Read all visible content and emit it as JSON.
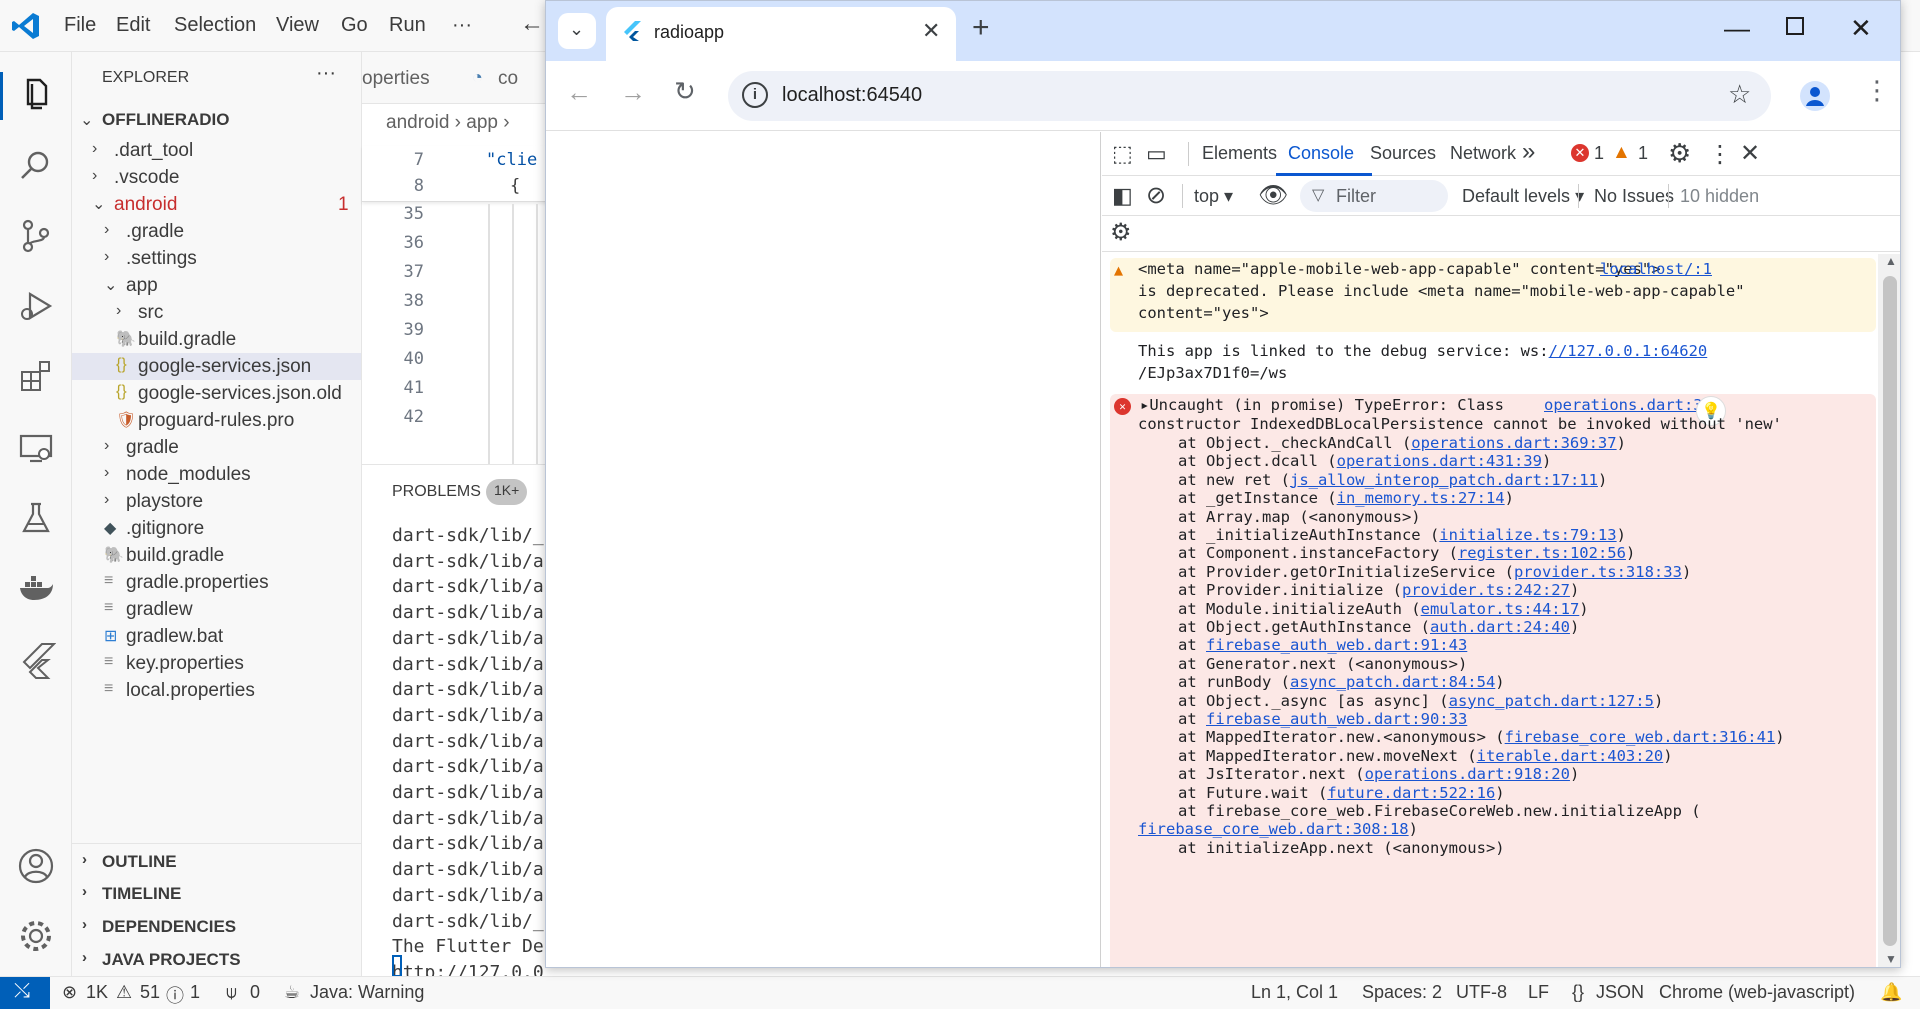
{
  "vscode": {
    "menu": [
      "File",
      "Edit",
      "Selection",
      "View",
      "Go",
      "Run",
      "···"
    ],
    "explorer": {
      "title": "EXPLORER",
      "more": "···",
      "root": "OFFLINERADIO",
      "items": [
        {
          "label": ".dart_tool",
          "depth": 1,
          "kind": "folder",
          "open": false
        },
        {
          "label": ".vscode",
          "depth": 1,
          "kind": "folder",
          "open": false
        },
        {
          "label": "android",
          "depth": 1,
          "kind": "folder",
          "open": true,
          "badge": "1"
        },
        {
          "label": ".gradle",
          "depth": 2,
          "kind": "folder",
          "open": false
        },
        {
          "label": ".settings",
          "depth": 2,
          "kind": "folder",
          "open": false
        },
        {
          "label": "app",
          "depth": 2,
          "kind": "folder",
          "open": true
        },
        {
          "label": "src",
          "depth": 3,
          "kind": "folder",
          "open": false
        },
        {
          "label": "build.gradle",
          "depth": 3,
          "kind": "gradle"
        },
        {
          "label": "google-services.json",
          "depth": 3,
          "kind": "json",
          "selected": true
        },
        {
          "label": "google-services.json.old",
          "depth": 3,
          "kind": "json"
        },
        {
          "label": "proguard-rules.pro",
          "depth": 3,
          "kind": "pro"
        },
        {
          "label": "gradle",
          "depth": 2,
          "kind": "folder",
          "open": false
        },
        {
          "label": "node_modules",
          "depth": 2,
          "kind": "folder",
          "open": false
        },
        {
          "label": "playstore",
          "depth": 2,
          "kind": "folder",
          "open": false
        },
        {
          "label": ".gitignore",
          "depth": 2,
          "kind": "git"
        },
        {
          "label": "build.gradle",
          "depth": 2,
          "kind": "gradle"
        },
        {
          "label": "gradle.properties",
          "depth": 2,
          "kind": "text"
        },
        {
          "label": "gradlew",
          "depth": 2,
          "kind": "text"
        },
        {
          "label": "gradlew.bat",
          "depth": 2,
          "kind": "win"
        },
        {
          "label": "key.properties",
          "depth": 2,
          "kind": "text"
        },
        {
          "label": "local.properties",
          "depth": 2,
          "kind": "text"
        }
      ],
      "sections": [
        "OUTLINE",
        "TIMELINE",
        "DEPENDENCIES",
        "JAVA PROJECTS"
      ]
    },
    "editor": {
      "tab1": "operties",
      "tab2": "co",
      "breadcrumb": [
        "android",
        "app"
      ],
      "sticky_lines": [
        {
          "n": "7",
          "text": "\"clie"
        },
        {
          "n": "8",
          "text": "{"
        }
      ],
      "line_numbers": [
        "35",
        "36",
        "37",
        "38",
        "39",
        "40",
        "41",
        "42"
      ]
    },
    "panel": {
      "title": "PROBLEMS",
      "badge": "1K+",
      "lines": [
        "dart-sdk/lib/_",
        "dart-sdk/lib/a",
        "dart-sdk/lib/a",
        "dart-sdk/lib/a",
        "dart-sdk/lib/a",
        "dart-sdk/lib/a",
        "dart-sdk/lib/a",
        "dart-sdk/lib/a",
        "dart-sdk/lib/a",
        "dart-sdk/lib/a",
        "dart-sdk/lib/a",
        "dart-sdk/lib/a",
        "dart-sdk/lib/a",
        "dart-sdk/lib/a",
        "dart-sdk/lib/a",
        "dart-sdk/lib/_",
        "The Flutter De",
        "http://127.0.0"
      ]
    },
    "status": {
      "errors": "1K",
      "warnings": "51",
      "info": "1",
      "ports": "0",
      "java": "Java: Warning",
      "position": "Ln 1, Col 1",
      "spaces": "Spaces: 2",
      "encoding": "UTF-8",
      "eol": "LF",
      "language": "JSON",
      "debug_target": "Chrome (web-javascript)"
    }
  },
  "chrome": {
    "tab_title": "radioapp",
    "url": "localhost:64540",
    "devtools": {
      "tabs": [
        "Elements",
        "Console",
        "Sources",
        "Network"
      ],
      "active_tab": "Console",
      "error_count": "1",
      "warning_count": "1",
      "context": "top",
      "filter_placeholder": "Filter",
      "levels": "Default levels",
      "issues": "No Issues",
      "hidden": "10 hidden",
      "warning_msg": {
        "line1": "<meta name=\"apple-mobile-web-app-capable\" content=\"yes\">",
        "source": "localhost/:1",
        "line2": "is deprecated. Please include <meta name=\"mobile-web-app-capable\"",
        "line3": "content=\"yes\">"
      },
      "info_msg": {
        "line1_prefix": "This app is linked to the debug service: ws:",
        "line1_link": "//127.0.0.1:64620",
        "line2": "/EJp3ax7D1f0=/ws"
      },
      "error_msg": {
        "head": "Uncaught (in promise) TypeError: Class",
        "source": "operations.dart:369",
        "line2": "constructor IndexedDBLocalPersistence cannot be invoked without 'new'",
        "stack": [
          {
            "pre": "at Object._checkAndCall (",
            "link": "operations.dart:369:37",
            "post": ")"
          },
          {
            "pre": "at Object.dcall (",
            "link": "operations.dart:431:39",
            "post": ")"
          },
          {
            "pre": "at new ret (",
            "link": "js_allow_interop_patch.dart:17:11",
            "post": ")"
          },
          {
            "pre": "at _getInstance (",
            "link": "in_memory.ts:27:14",
            "post": ")"
          },
          {
            "pre": "at Array.map (<anonymous>)",
            "link": "",
            "post": ""
          },
          {
            "pre": "at _initializeAuthInstance (",
            "link": "initialize.ts:79:13",
            "post": ")"
          },
          {
            "pre": "at Component.instanceFactory (",
            "link": "register.ts:102:56",
            "post": ")"
          },
          {
            "pre": "at Provider.getOrInitializeService (",
            "link": "provider.ts:318:33",
            "post": ")"
          },
          {
            "pre": "at Provider.initialize (",
            "link": "provider.ts:242:27",
            "post": ")"
          },
          {
            "pre": "at Module.initializeAuth (",
            "link": "emulator.ts:44:17",
            "post": ")"
          },
          {
            "pre": "at Object.getAuthInstance (",
            "link": "auth.dart:24:40",
            "post": ")"
          },
          {
            "pre": "at ",
            "link": "firebase_auth_web.dart:91:43",
            "post": ""
          },
          {
            "pre": "at Generator.next (<anonymous>)",
            "link": "",
            "post": ""
          },
          {
            "pre": "at runBody (",
            "link": "async_patch.dart:84:54",
            "post": ")"
          },
          {
            "pre": "at Object._async [as async] (",
            "link": "async_patch.dart:127:5",
            "post": ")"
          },
          {
            "pre": "at ",
            "link": "firebase_auth_web.dart:90:33",
            "post": ""
          },
          {
            "pre": "at MappedIterator.new.<anonymous> (",
            "link": "firebase_core_web.dart:316:41",
            "post": ")"
          },
          {
            "pre": "at MappedIterator.new.moveNext (",
            "link": "iterable.dart:403:20",
            "post": ")"
          },
          {
            "pre": "at JsIterator.next (",
            "link": "operations.dart:918:20",
            "post": ")"
          },
          {
            "pre": "at Future.wait (",
            "link": "future.dart:522:16",
            "post": ")"
          },
          {
            "pre": "at firebase_core_web.FirebaseCoreWeb.new.initializeApp (",
            "link": "",
            "post": ""
          }
        ],
        "wrap_link": "firebase_core_web.dart:308:18",
        "last": "at initializeApp.next (<anonymous>)"
      }
    }
  }
}
